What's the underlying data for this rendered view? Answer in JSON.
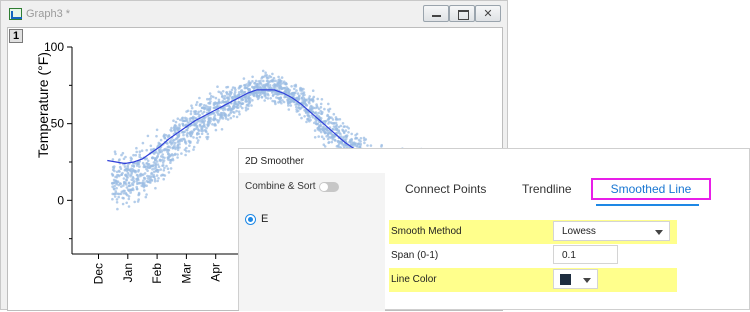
{
  "window": {
    "title": "Graph3 *",
    "close_glyph": "✕",
    "layer_number": "1"
  },
  "chart_data": {
    "type": "scatter",
    "title": "",
    "xlabel": "",
    "ylabel": "Temperature (°F)",
    "ylim": [
      -35,
      100
    ],
    "yticks": [
      0,
      50,
      100
    ],
    "xticks": [
      "Dec",
      "Jan",
      "Feb",
      "Mar",
      "Apr"
    ],
    "x_unit": "month (Dec start, continuous)",
    "series": [
      {
        "kind": "scatter_band",
        "color": "#9bbce3",
        "x": [
          0.3,
          0.6,
          0.9,
          1.2,
          1.5,
          1.8,
          2.1,
          2.4,
          2.7,
          3.0,
          3.3,
          3.6,
          3.9,
          4.2,
          4.5,
          4.8,
          5.1,
          5.4,
          5.7,
          6.0,
          6.3,
          6.6,
          6.9,
          7.2,
          7.5,
          7.8,
          8.1,
          8.4,
          8.7,
          9.0,
          9.3,
          9.6,
          9.9,
          10.2,
          10.5,
          10.8,
          11.1,
          11.4
        ],
        "ymin": [
          -5,
          -9,
          -9,
          -7,
          -5,
          1,
          5,
          12,
          19,
          25,
          30,
          35,
          39,
          44,
          48,
          52,
          56,
          60,
          62,
          61,
          59,
          55,
          51,
          45,
          38,
          31,
          25,
          20,
          15,
          10,
          6,
          3,
          1,
          0,
          0,
          0,
          0,
          0
        ],
        "ymax": [
          42,
          38,
          38,
          40,
          43,
          48,
          51,
          56,
          61,
          65,
          69,
          72,
          74,
          76,
          78,
          81,
          83,
          85,
          86,
          86,
          84,
          81,
          78,
          74,
          70,
          65,
          60,
          55,
          50,
          46,
          42,
          40,
          38,
          37,
          37,
          37,
          37,
          37
        ]
      },
      {
        "kind": "line",
        "name": "",
        "color": "#2f3fd9",
        "x": [
          0.3,
          0.6,
          0.9,
          1.2,
          1.5,
          1.8,
          2.1,
          2.4,
          2.7,
          3.0,
          3.3,
          3.6,
          3.9,
          4.2,
          4.5,
          4.8,
          5.1,
          5.4,
          5.7,
          6.0,
          6.3,
          6.6,
          6.9,
          7.2,
          7.5,
          7.8,
          8.1,
          8.4,
          8.7,
          9.0,
          9.3,
          9.6
        ],
        "y": [
          26,
          25,
          24,
          25,
          27,
          31,
          35,
          40,
          44,
          48,
          52,
          55,
          58,
          61,
          64,
          67,
          70,
          72,
          72,
          72,
          70,
          67,
          63,
          58,
          53,
          48,
          43,
          38,
          34,
          30,
          27,
          25
        ]
      }
    ]
  },
  "dialog": {
    "title": "2D Smoother",
    "combine_sort_label": "Combine & Sort",
    "combine_sort_on": false,
    "dataset_label": "E",
    "tabs": [
      "Connect Points",
      "Trendline",
      "Smoothed Line"
    ],
    "active_tab": "Smoothed Line",
    "smooth_method": {
      "label": "Smooth Method",
      "value": "Lowess"
    },
    "span": {
      "label": "Span (0-1)",
      "value": "0.1"
    },
    "line_color": {
      "label": "Line Color",
      "value": "#1e2d40"
    }
  }
}
